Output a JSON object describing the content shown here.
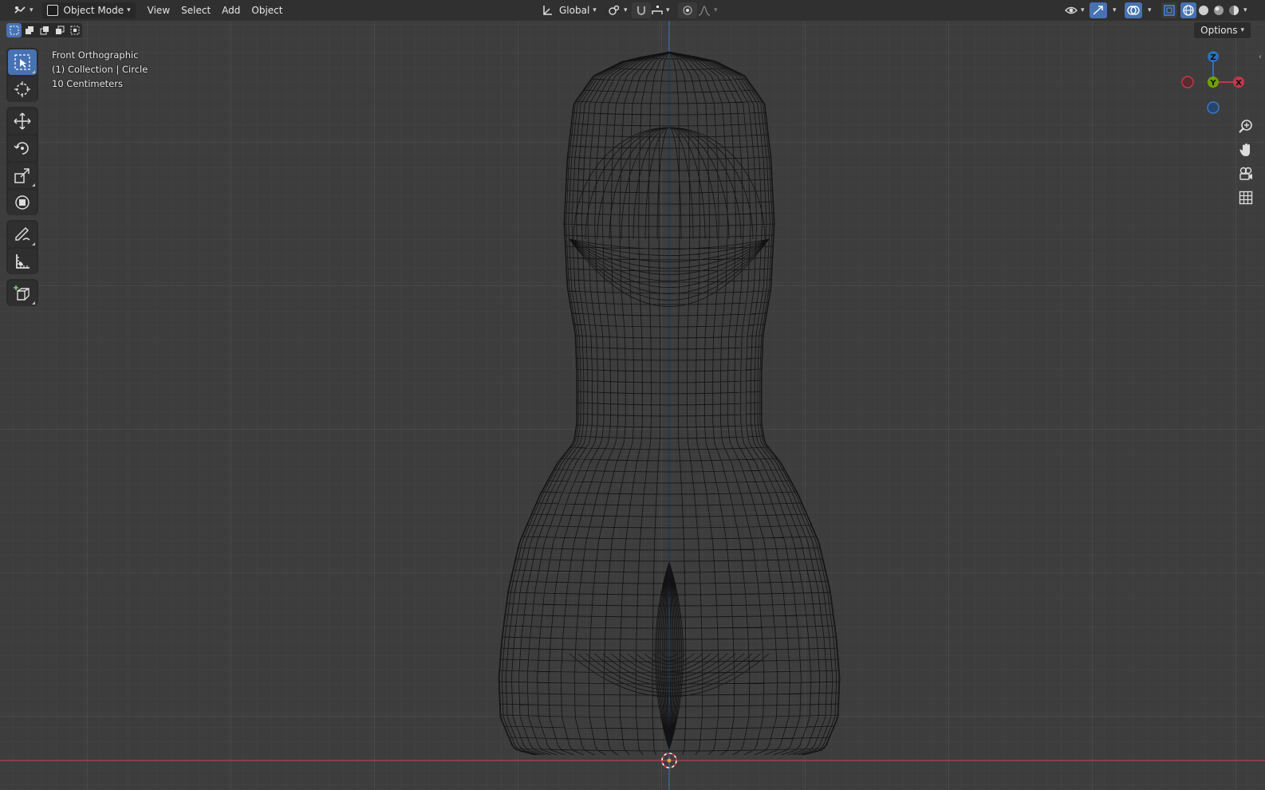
{
  "header": {
    "mode_label": "Object Mode",
    "menus": [
      "View",
      "Select",
      "Add",
      "Object"
    ],
    "orientation_label": "Global"
  },
  "overlay": {
    "view_name": "Front Orthographic",
    "collection_info": "(1) Collection | Circle",
    "scale_info": "10 Centimeters"
  },
  "options_label": "Options",
  "gizmo": {
    "z_label": "Z",
    "y_label": "Y",
    "x_label": "X"
  },
  "colors": {
    "active_blue": "#4772b3",
    "x_axis_red": "#c0394b",
    "z_axis_blue": "#2c6fbf",
    "y_axis_green": "#6da300"
  },
  "icons": {
    "tools": [
      "select-box-icon",
      "cursor-icon",
      "move-icon",
      "rotate-icon",
      "scale-icon",
      "transform-icon",
      "annotate-icon",
      "measure-icon",
      "add-cube-icon"
    ],
    "nav": [
      "zoom-icon",
      "pan-hand-icon",
      "camera-icon",
      "grid-ortho-icon"
    ]
  }
}
